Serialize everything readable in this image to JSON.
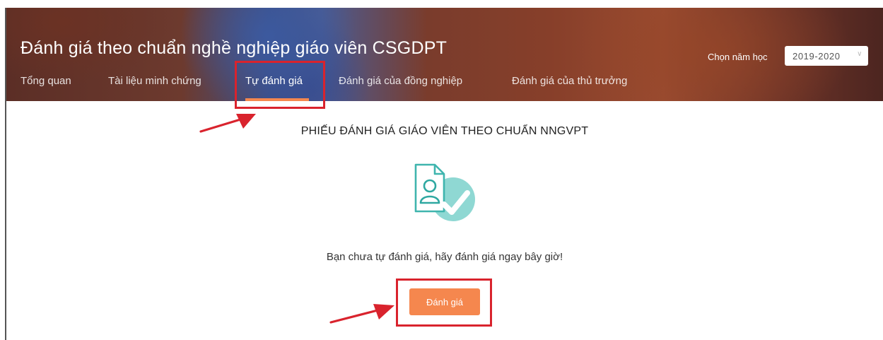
{
  "header": {
    "title": "Đánh giá theo chuẩn nghề nghiệp giáo viên CSGDPT",
    "year_label": "Chọn năm học",
    "year_value": "2019-2020"
  },
  "tabs": [
    {
      "label": "Tổng quan"
    },
    {
      "label": "Tài liệu minh chứng"
    },
    {
      "label": "Tự đánh giá"
    },
    {
      "label": "Đánh giá của đồng nghiệp"
    },
    {
      "label": "Đánh giá của thủ trưởng"
    }
  ],
  "active_tab": "Tự đánh giá",
  "main": {
    "form_title": "PHIẾU ĐÁNH GIÁ GIÁO VIÊN THEO CHUẨN NNGVPT",
    "icon": "document-user-check-icon",
    "message": "Bạn chưa tự đánh giá, hãy đánh giá ngay bây giờ!",
    "button_label": "Đánh giá"
  },
  "colors": {
    "accent": "#f5874e",
    "annotation_red": "#d9232d",
    "icon_teal": "#4fc1bc"
  }
}
